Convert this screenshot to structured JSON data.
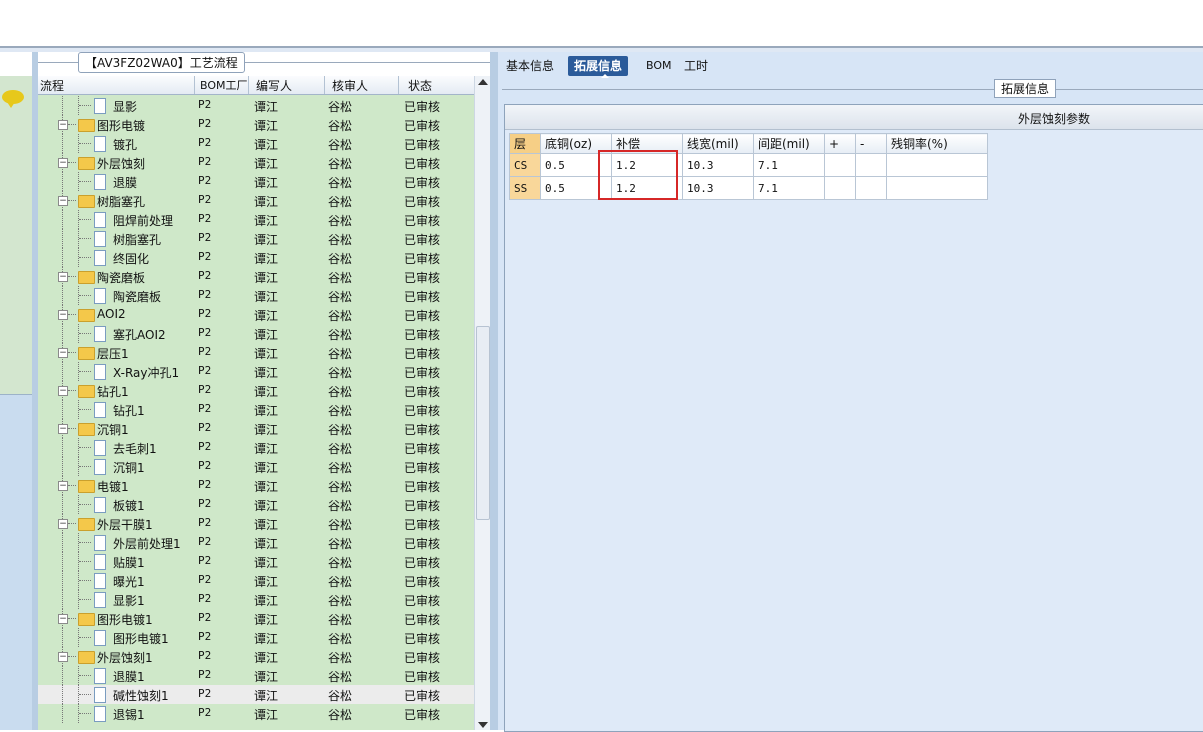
{
  "left_panel": {
    "group_title": "【AV3FZ02WA0】工艺流程",
    "columns": [
      "流程",
      "BOM工厂",
      "编写人",
      "核审人",
      "状态"
    ],
    "rows": [
      {
        "name": "显影",
        "type": "doc",
        "level": 2,
        "bom": "P2",
        "writer": "谭江",
        "reviewer": "谷松",
        "status": "已审核"
      },
      {
        "name": "图形电镀",
        "type": "folder",
        "level": 1,
        "bom": "P2",
        "writer": "谭江",
        "reviewer": "谷松",
        "status": "已审核"
      },
      {
        "name": "镀孔",
        "type": "doc",
        "level": 2,
        "bom": "P2",
        "writer": "谭江",
        "reviewer": "谷松",
        "status": "已审核"
      },
      {
        "name": "外层蚀刻",
        "type": "folder",
        "level": 1,
        "bom": "P2",
        "writer": "谭江",
        "reviewer": "谷松",
        "status": "已审核"
      },
      {
        "name": "退膜",
        "type": "doc",
        "level": 2,
        "bom": "P2",
        "writer": "谭江",
        "reviewer": "谷松",
        "status": "已审核"
      },
      {
        "name": "树脂塞孔",
        "type": "folder",
        "level": 1,
        "bom": "P2",
        "writer": "谭江",
        "reviewer": "谷松",
        "status": "已审核"
      },
      {
        "name": "阻焊前处理",
        "type": "doc",
        "level": 2,
        "bom": "P2",
        "writer": "谭江",
        "reviewer": "谷松",
        "status": "已审核"
      },
      {
        "name": "树脂塞孔",
        "type": "doc",
        "level": 2,
        "bom": "P2",
        "writer": "谭江",
        "reviewer": "谷松",
        "status": "已审核"
      },
      {
        "name": "终固化",
        "type": "doc",
        "level": 2,
        "bom": "P2",
        "writer": "谭江",
        "reviewer": "谷松",
        "status": "已审核"
      },
      {
        "name": "陶瓷磨板",
        "type": "folder",
        "level": 1,
        "bom": "P2",
        "writer": "谭江",
        "reviewer": "谷松",
        "status": "已审核"
      },
      {
        "name": "陶瓷磨板",
        "type": "doc",
        "level": 2,
        "bom": "P2",
        "writer": "谭江",
        "reviewer": "谷松",
        "status": "已审核"
      },
      {
        "name": "AOI2",
        "type": "folder",
        "level": 1,
        "bom": "P2",
        "writer": "谭江",
        "reviewer": "谷松",
        "status": "已审核"
      },
      {
        "name": "塞孔AOI2",
        "type": "doc",
        "level": 2,
        "bom": "P2",
        "writer": "谭江",
        "reviewer": "谷松",
        "status": "已审核"
      },
      {
        "name": "层压1",
        "type": "folder",
        "level": 1,
        "bom": "P2",
        "writer": "谭江",
        "reviewer": "谷松",
        "status": "已审核"
      },
      {
        "name": "X-Ray冲孔1",
        "type": "doc",
        "level": 2,
        "bom": "P2",
        "writer": "谭江",
        "reviewer": "谷松",
        "status": "已审核"
      },
      {
        "name": "钻孔1",
        "type": "folder",
        "level": 1,
        "bom": "P2",
        "writer": "谭江",
        "reviewer": "谷松",
        "status": "已审核"
      },
      {
        "name": "钻孔1",
        "type": "doc",
        "level": 2,
        "bom": "P2",
        "writer": "谭江",
        "reviewer": "谷松",
        "status": "已审核"
      },
      {
        "name": "沉铜1",
        "type": "folder",
        "level": 1,
        "bom": "P2",
        "writer": "谭江",
        "reviewer": "谷松",
        "status": "已审核"
      },
      {
        "name": "去毛刺1",
        "type": "doc",
        "level": 2,
        "bom": "P2",
        "writer": "谭江",
        "reviewer": "谷松",
        "status": "已审核"
      },
      {
        "name": "沉铜1",
        "type": "doc",
        "level": 2,
        "bom": "P2",
        "writer": "谭江",
        "reviewer": "谷松",
        "status": "已审核"
      },
      {
        "name": "电镀1",
        "type": "folder",
        "level": 1,
        "bom": "P2",
        "writer": "谭江",
        "reviewer": "谷松",
        "status": "已审核"
      },
      {
        "name": "板镀1",
        "type": "doc",
        "level": 2,
        "bom": "P2",
        "writer": "谭江",
        "reviewer": "谷松",
        "status": "已审核"
      },
      {
        "name": "外层干膜1",
        "type": "folder",
        "level": 1,
        "bom": "P2",
        "writer": "谭江",
        "reviewer": "谷松",
        "status": "已审核"
      },
      {
        "name": "外层前处理1",
        "type": "doc",
        "level": 2,
        "bom": "P2",
        "writer": "谭江",
        "reviewer": "谷松",
        "status": "已审核"
      },
      {
        "name": "贴膜1",
        "type": "doc",
        "level": 2,
        "bom": "P2",
        "writer": "谭江",
        "reviewer": "谷松",
        "status": "已审核"
      },
      {
        "name": "曝光1",
        "type": "doc",
        "level": 2,
        "bom": "P2",
        "writer": "谭江",
        "reviewer": "谷松",
        "status": "已审核"
      },
      {
        "name": "显影1",
        "type": "doc",
        "level": 2,
        "bom": "P2",
        "writer": "谭江",
        "reviewer": "谷松",
        "status": "已审核"
      },
      {
        "name": "图形电镀1",
        "type": "folder",
        "level": 1,
        "bom": "P2",
        "writer": "谭江",
        "reviewer": "谷松",
        "status": "已审核"
      },
      {
        "name": "图形电镀1",
        "type": "doc",
        "level": 2,
        "bom": "P2",
        "writer": "谭江",
        "reviewer": "谷松",
        "status": "已审核"
      },
      {
        "name": "外层蚀刻1",
        "type": "folder",
        "level": 1,
        "bom": "P2",
        "writer": "谭江",
        "reviewer": "谷松",
        "status": "已审核"
      },
      {
        "name": "退膜1",
        "type": "doc",
        "level": 2,
        "bom": "P2",
        "writer": "谭江",
        "reviewer": "谷松",
        "status": "已审核"
      },
      {
        "name": "碱性蚀刻1",
        "type": "doc",
        "level": 2,
        "bom": "P2",
        "writer": "谭江",
        "reviewer": "谷松",
        "status": "已审核",
        "selected": true
      },
      {
        "name": "退锡1",
        "type": "doc",
        "level": 2,
        "bom": "P2",
        "writer": "谭江",
        "reviewer": "谷松",
        "status": "已审核"
      }
    ]
  },
  "right_panel": {
    "tabs": [
      "基本信息",
      "拓展信息",
      "BOM",
      "工时"
    ],
    "active_tab": 1,
    "group_title": "拓展信息",
    "section_title": "外层蚀刻参数",
    "table": {
      "headers": [
        "层",
        "底铜(oz)",
        "补偿",
        "线宽(mil)",
        "间距(mil)",
        "+",
        "-",
        "残铜率(%)"
      ],
      "rows": [
        [
          "CS",
          "0.5",
          "1.2",
          "10.3",
          "7.1",
          "",
          "",
          ""
        ],
        [
          "SS",
          "0.5",
          "1.2",
          "10.3",
          "7.1",
          "",
          "",
          ""
        ]
      ]
    }
  },
  "colors": {
    "tree_background": "#cfe8c9",
    "active_tab": "#2b5b9a",
    "highlight_box": "#d62727",
    "layer_cell": "#f9d79a"
  }
}
